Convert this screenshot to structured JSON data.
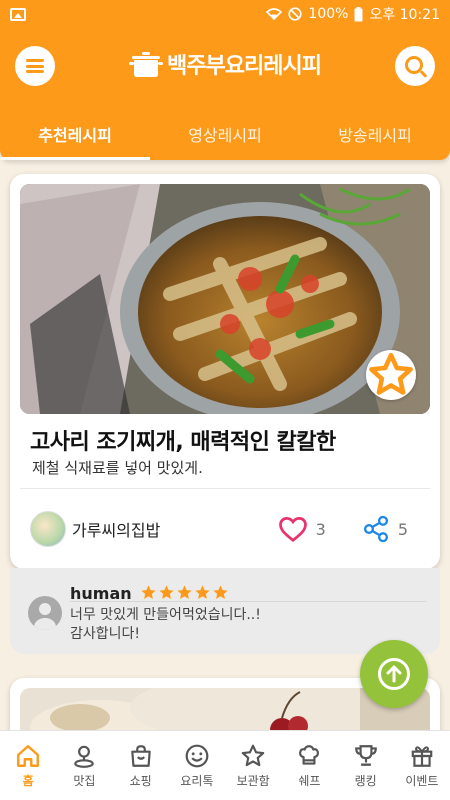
{
  "status_bar": {
    "battery": "100%",
    "time": "오후 10:21",
    "left_icon": "gallery-icon",
    "right_icons": [
      "wifi-icon",
      "do-not-disturb-icon",
      "battery-icon"
    ]
  },
  "app_bar": {
    "logo_text": "백주부요리레시피",
    "menu_icon": "hamburger-icon",
    "search_icon": "search-icon"
  },
  "tabs": [
    {
      "label": "추천레시피",
      "active": true
    },
    {
      "label": "영상레시피",
      "active": false
    },
    {
      "label": "방송레시피",
      "active": false
    }
  ],
  "recipe": {
    "title": "고사리 조기찌개, 매력적인 칼칼한",
    "description": "제철 식재료를 넣어 맛있게.",
    "author": "가루씨의집밥",
    "likes": "3",
    "shares": "5",
    "favorite_icon": "star-outline-icon"
  },
  "comment": {
    "user": "human",
    "rating": 5,
    "text_line1": "너무 맛있게 만들어먹었습니다..!",
    "text_line2": "감사합니다!"
  },
  "fab": {
    "icon": "arrow-up-circle-icon"
  },
  "bottom_nav": [
    {
      "label": "홈",
      "icon": "home-icon",
      "active": true
    },
    {
      "label": "맛집",
      "icon": "map-pin-icon",
      "active": false
    },
    {
      "label": "쇼핑",
      "icon": "shopping-bag-icon",
      "active": false
    },
    {
      "label": "요리톡",
      "icon": "smile-icon",
      "active": false
    },
    {
      "label": "보관함",
      "icon": "star-icon",
      "active": false
    },
    {
      "label": "쉐프",
      "icon": "chef-icon",
      "active": false
    },
    {
      "label": "랭킹",
      "icon": "trophy-icon",
      "active": false
    },
    {
      "label": "이벤트",
      "icon": "gift-icon",
      "active": false
    }
  ],
  "colors": {
    "brand": "#fd9a1a",
    "accent_heart": "#e8336d",
    "accent_share": "#1e88e5",
    "star": "#fd9a1a",
    "fab": "#94c23a"
  }
}
